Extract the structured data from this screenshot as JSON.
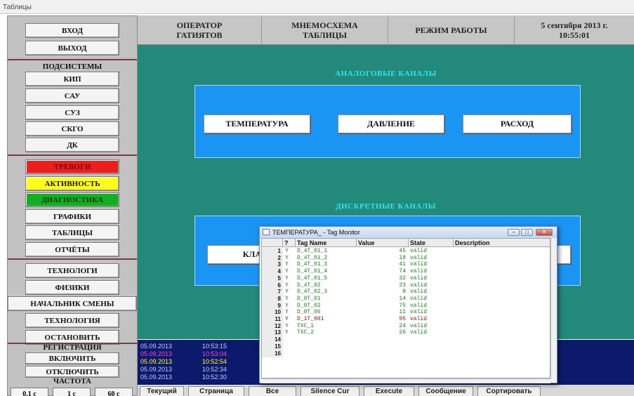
{
  "window": {
    "title": "Таблицы"
  },
  "sidebar": {
    "top_buttons": [
      "ВХОД",
      "ВЫХОД"
    ],
    "subsystems_label": "ПОДСИСТЕМЫ",
    "subsystems": [
      "КИП",
      "САУ",
      "СУЗ",
      "СКГО",
      "ДК"
    ],
    "status_buttons": [
      {
        "label": "ТРЕВОГИ",
        "color": "#ee1e1e"
      },
      {
        "label": "АКТИВНОСТЬ",
        "color": "#ffff18"
      },
      {
        "label": "ДИАГНОСТИКА",
        "color": "#10b020"
      }
    ],
    "view_buttons": [
      "ГРАФИКИ",
      "ТАБЛИЦЫ",
      "ОТЧЁТЫ"
    ],
    "role_buttons": [
      "ТЕХНОЛОГИ",
      "ФИЗИКИ",
      "НАЧАЛЬНИК СМЕНЫ",
      "ТЕХНОЛОГИЯ",
      "ОСТАНОВИТЬ"
    ],
    "registration_label": "РЕГИСТРАЦИЯ",
    "registration_buttons": [
      "ВКЛЮЧИТЬ",
      "ОТКЛЮЧИТЬ"
    ],
    "frequency_label": "ЧАСТОТА",
    "frequency_buttons": [
      "0,1 с",
      "1 с",
      "60 с"
    ]
  },
  "header": {
    "operator": "ОПЕРАТОР ГАТИЯТОВ",
    "mnemo": "МНЕМОСХЕМА ТАБЛИЦЫ",
    "mode": "РЕЖИМ РАБОТЫ",
    "datetime": "5 сентября 2013 г. 10:55:01"
  },
  "main": {
    "analog_title": "АНАЛОГОВЫЕ КАНАЛЫ",
    "analog_buttons": [
      "ТЕМПЕРАТУРА",
      "ДАВЛЕНИЕ",
      "РАСХОД"
    ],
    "discrete_title": "ДИСКРЕТНЫЕ КАНАЛЫ",
    "discrete_button_partial": "КЛА",
    "colors": {
      "background": "#22897b",
      "panel": "#1a95f4",
      "section_title": "#2ee6f0"
    }
  },
  "alarm_log": [
    {
      "date": "05.09.2013",
      "time": "10:53:15",
      "color": "#c8c8ff"
    },
    {
      "date": "05.09.2013",
      "time": "10:53:04",
      "color": "#ff44cc"
    },
    {
      "date": "05.09.2013",
      "time": "10:52:54",
      "color": "#ffff30"
    },
    {
      "date": "05.09.2013",
      "time": "10:52:34",
      "color": "#c8c8ff"
    },
    {
      "date": "05.09.2013",
      "time": "10:52:30",
      "color": "#c8c8ff"
    }
  ],
  "bottom_tabs": [
    "Текущий",
    "Страница",
    "Все",
    "Silence Cur",
    "Execute",
    "Сообщение",
    "Сортировать"
  ],
  "tag_monitor": {
    "title": "ТЕМПЕРАТУРА_ - Tag Monitor",
    "columns": [
      "?",
      "Tag Name",
      "Value",
      "State",
      "Description"
    ],
    "rows": [
      {
        "n": "1",
        "flag": "Y",
        "tag": "D_4T_01_1",
        "value": "45",
        "state": "valid",
        "color": "#1a7a1a"
      },
      {
        "n": "2",
        "flag": "Y",
        "tag": "D_4T_01_2",
        "value": "18",
        "state": "valid",
        "color": "#1a7a1a"
      },
      {
        "n": "3",
        "flag": "Y",
        "tag": "D_4T_01_3",
        "value": "41",
        "state": "valid",
        "color": "#1a7a1a"
      },
      {
        "n": "4",
        "flag": "Y",
        "tag": "D_4T_01_4",
        "value": "74",
        "state": "valid",
        "color": "#1a7a1a"
      },
      {
        "n": "5",
        "flag": "Y",
        "tag": "D_4T_01_5",
        "value": "32",
        "state": "valid",
        "color": "#1a7a1a"
      },
      {
        "n": "6",
        "flag": "Y",
        "tag": "D_4T_02",
        "value": "23",
        "state": "valid",
        "color": "#1a7a1a"
      },
      {
        "n": "7",
        "flag": "Y",
        "tag": "D_4T_02_3",
        "value": "8",
        "state": "valid",
        "color": "#1a7a1a"
      },
      {
        "n": "8",
        "flag": "Y",
        "tag": "D_0T_01",
        "value": "14",
        "state": "valid",
        "color": "#1a7a1a"
      },
      {
        "n": "9",
        "flag": "Y",
        "tag": "D_0T_02",
        "value": "75",
        "state": "valid",
        "color": "#1a7a1a"
      },
      {
        "n": "10",
        "flag": "Y",
        "tag": "D_0T_06",
        "value": "11",
        "state": "valid",
        "color": "#1a7a1a"
      },
      {
        "n": "11",
        "flag": "Y",
        "tag": "D_1T_001",
        "value": "95",
        "state": "valid",
        "color": "#8a1010"
      },
      {
        "n": "12",
        "flag": "Y",
        "tag": "TXC_1",
        "value": "24",
        "state": "valid",
        "color": "#1a7a1a"
      },
      {
        "n": "13",
        "flag": "Y",
        "tag": "TXC_2",
        "value": "26",
        "state": "valid",
        "color": "#1a7a1a"
      },
      {
        "n": "14",
        "flag": "",
        "tag": "",
        "value": "",
        "state": "",
        "color": "#1a7a1a"
      },
      {
        "n": "15",
        "flag": "",
        "tag": "",
        "value": "",
        "state": "",
        "color": "#1a7a1a"
      },
      {
        "n": "16",
        "flag": "",
        "tag": "",
        "value": "",
        "state": "",
        "color": "#1a7a1a"
      }
    ]
  }
}
